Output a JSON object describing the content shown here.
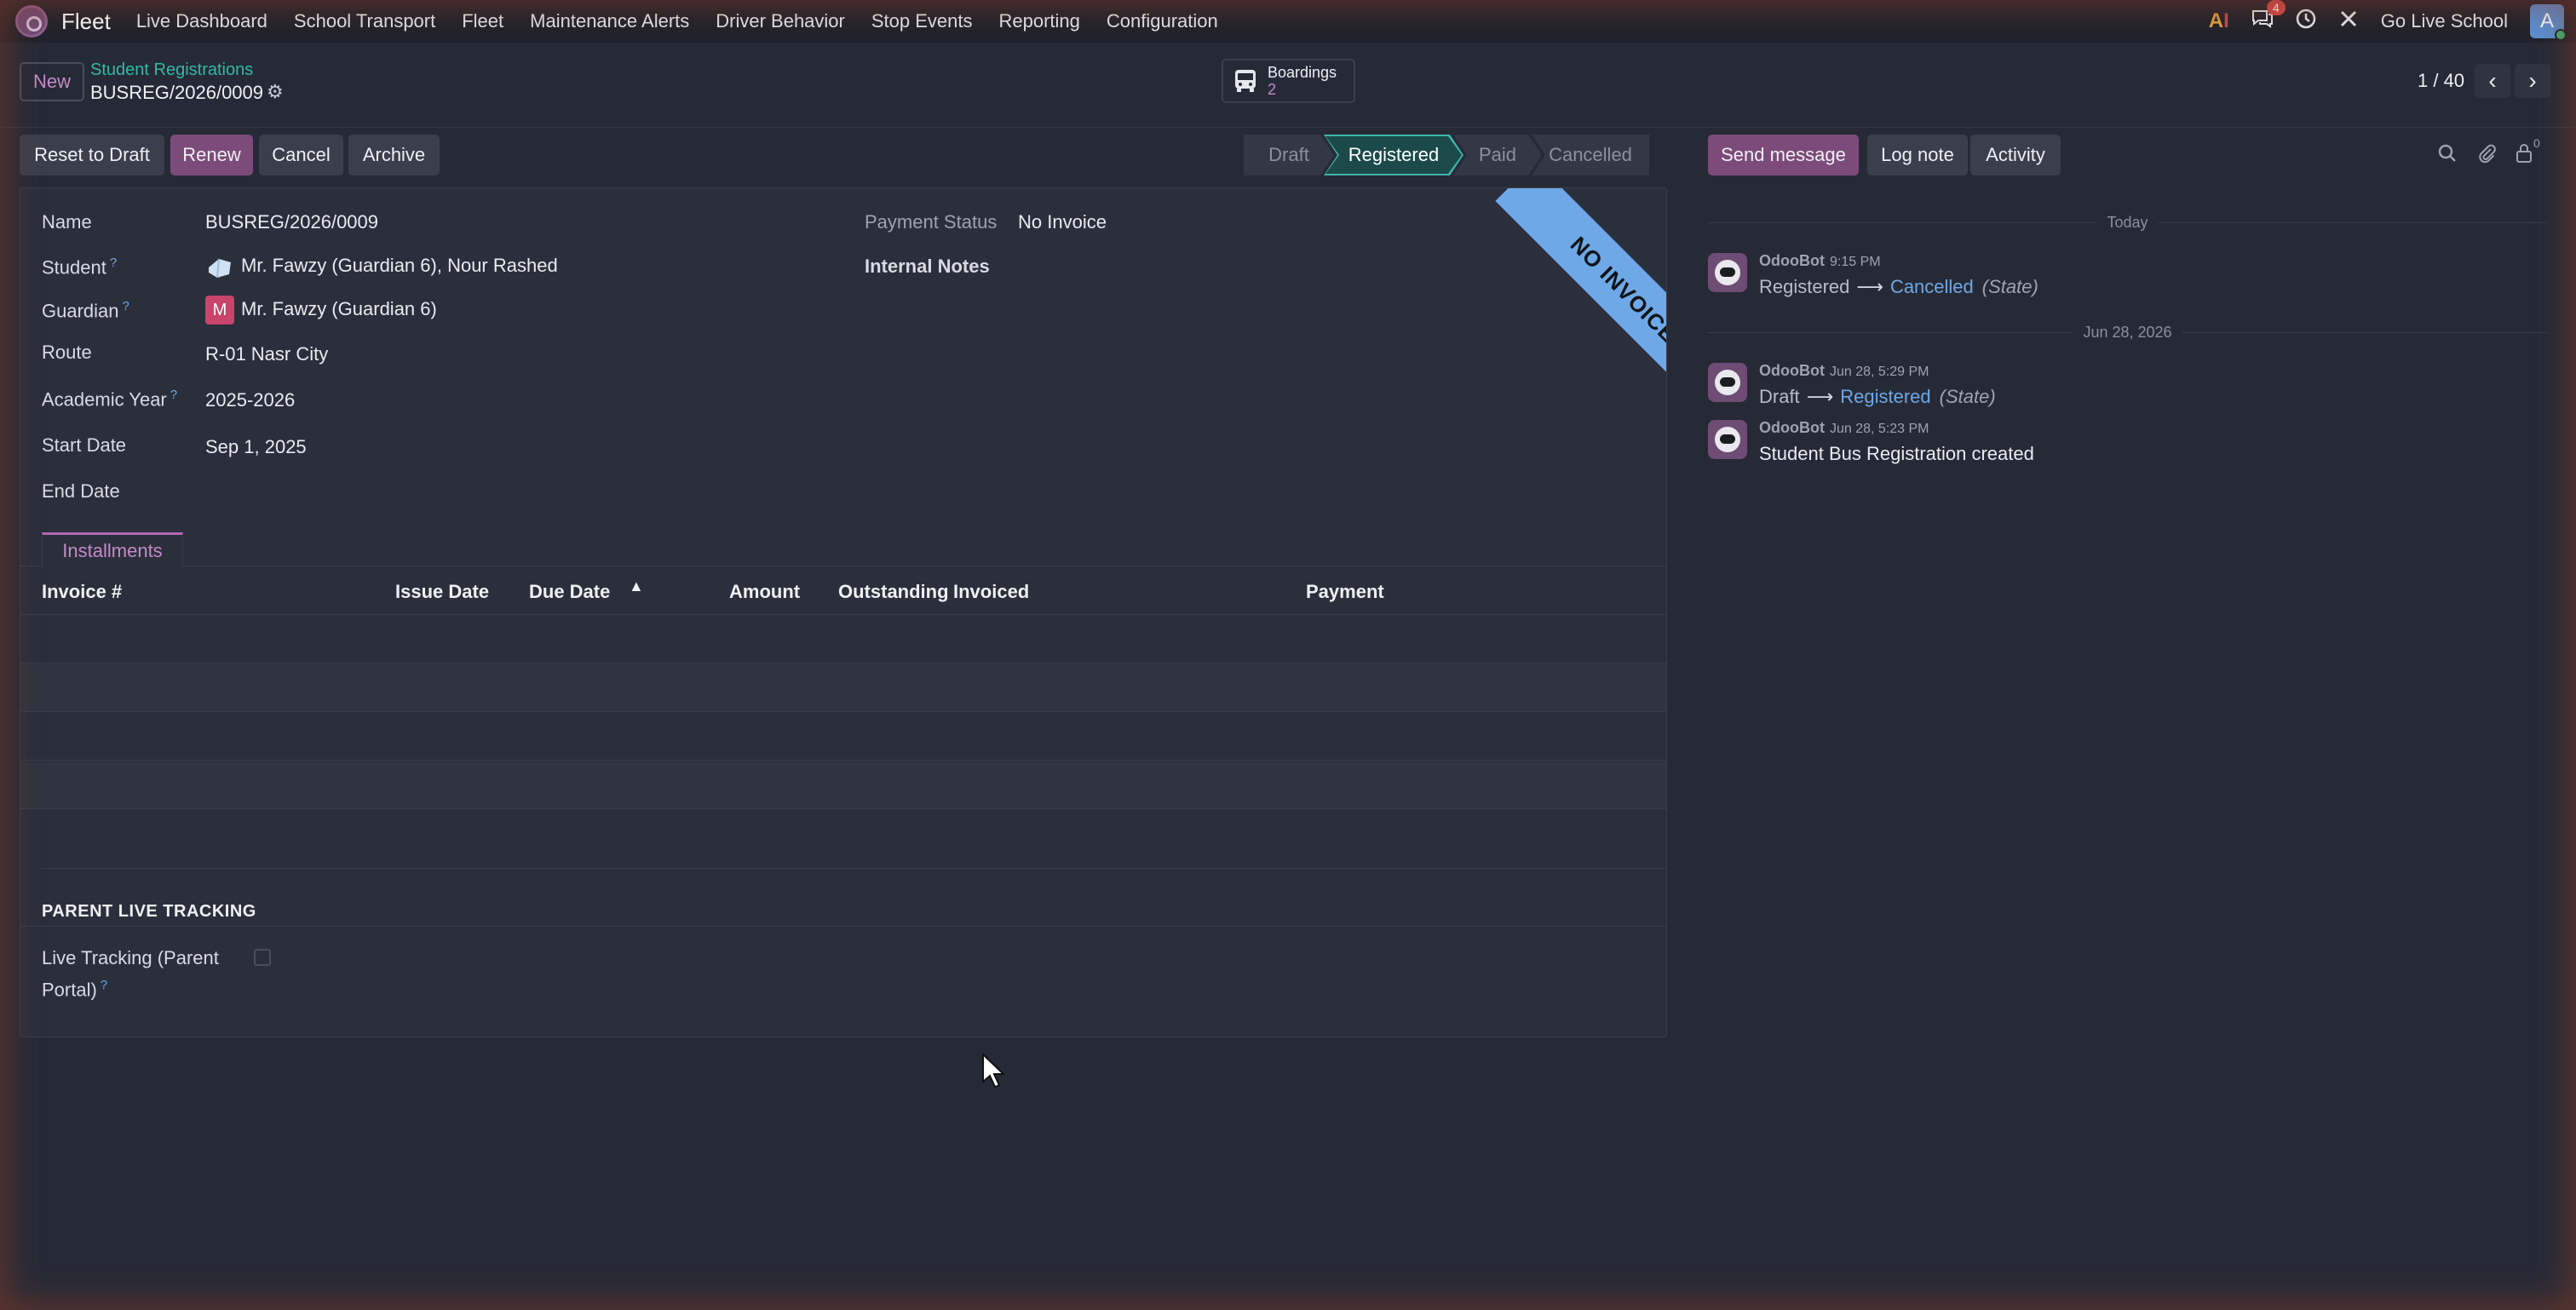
{
  "navbar": {
    "app_name": "Fleet",
    "menu": [
      "Live Dashboard",
      "School Transport",
      "Fleet",
      "Maintenance Alerts",
      "Driver Behavior",
      "Stop Events",
      "Reporting",
      "Configuration"
    ],
    "messages_badge": "4",
    "company": "Go Live School",
    "user_initial": "A"
  },
  "control_panel": {
    "new_label": "New",
    "breadcrumb": "Student Registrations",
    "record_name": "BUSREG/2026/0009",
    "smart_button": {
      "label": "Boardings",
      "value": "2"
    },
    "pager": "1 / 40"
  },
  "actions": {
    "reset": "Reset to Draft",
    "renew": "Renew",
    "cancel": "Cancel",
    "archive": "Archive"
  },
  "statusbar": {
    "stages": [
      "Draft",
      "Registered",
      "Paid",
      "Cancelled"
    ],
    "active": "Registered"
  },
  "ribbon": "NO INVOICE",
  "form": {
    "name_label": "Name",
    "name_value": "BUSREG/2026/0009",
    "student_label": "Student",
    "student_value": "Mr. Fawzy (Guardian 6), Nour Rashed",
    "guardian_label": "Guardian",
    "guardian_initial": "M",
    "guardian_value": "Mr. Fawzy (Guardian 6)",
    "route_label": "Route",
    "route_value": "R-01 Nasr City",
    "year_label": "Academic Year",
    "year_value": "2025-2026",
    "start_label": "Start Date",
    "start_value": "Sep 1, 2025",
    "end_label": "End Date",
    "end_value": "",
    "payment_status_label": "Payment Status",
    "payment_status_value": "No Invoice",
    "internal_notes_label": "Internal Notes",
    "help_mark": "?"
  },
  "tabs": [
    "Installments"
  ],
  "installments_table": {
    "columns": [
      "Invoice #",
      "Issue Date",
      "Due Date",
      "Amount",
      "Outstanding",
      "Invoiced",
      "Payment"
    ],
    "rows": []
  },
  "parent_tracking": {
    "section_title": "PARENT LIVE TRACKING",
    "label": "Live Tracking (Parent Portal)",
    "checked": false
  },
  "chatter": {
    "send_message": "Send message",
    "log_note": "Log note",
    "activity": "Activity",
    "followers_count": "0",
    "date_today": "Today",
    "date_older": "Jun 28, 2026",
    "messages": [
      {
        "author": "OdooBot",
        "time": "9:15 PM",
        "old": "Registered",
        "new": "Cancelled",
        "field": "(State)"
      },
      {
        "author": "OdooBot",
        "time": "Jun 28, 5:29 PM",
        "old": "Draft",
        "new": "Registered",
        "field": "(State)"
      },
      {
        "author": "OdooBot",
        "time": "Jun 28, 5:23 PM",
        "body": "Student Bus Registration created"
      }
    ]
  }
}
